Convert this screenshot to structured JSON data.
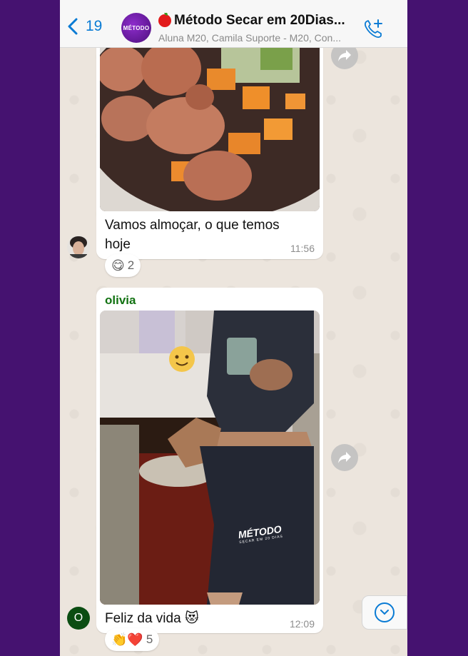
{
  "header": {
    "back_count": "19",
    "group_avatar_text": "MÉTODO",
    "title": "Método Secar em 20Dias...",
    "subtitle": "Aluna M20, Camila Suporte - M20, Con..."
  },
  "messages": [
    {
      "text_line1": "Vamos almoçar, o que temos",
      "text_line2": "hoje",
      "time": "11:56",
      "reaction_emojis": "😋",
      "reaction_count": "2"
    },
    {
      "sender": "olivia",
      "sender_initial": "O",
      "photo_watermark": "MÉTODO",
      "photo_watermark_sub": "SECAR EM 20 DIAS",
      "text": "Feliz da vida 😻",
      "time": "12:09",
      "reaction_emojis": "👏❤️",
      "reaction_count": "5"
    }
  ],
  "colors": {
    "background": "#451270",
    "accent_blue": "#0a7bd4",
    "sender_green": "#127212"
  }
}
